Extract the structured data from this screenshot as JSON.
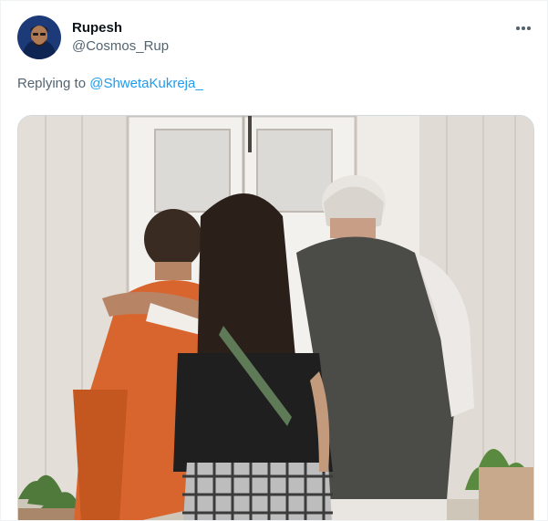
{
  "tweet": {
    "author_name": "Rupesh",
    "author_handle": "@Cosmos_Rup",
    "replying_prefix": "Replying to ",
    "replying_to": "@ShwetaKukreja_",
    "more_icon": "more-horizontal-icon",
    "avatar_icon": "profile-avatar",
    "media_description": "photo"
  },
  "colors": {
    "text_primary": "#0f1419",
    "text_secondary": "#536471",
    "link": "#1d9bf0",
    "border": "#cfd9de"
  }
}
